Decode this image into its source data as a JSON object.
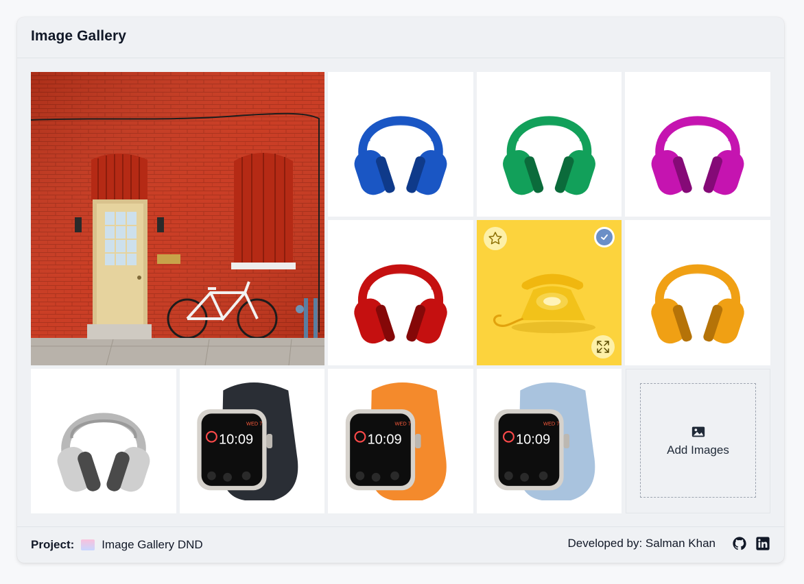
{
  "header": {
    "title": "Image Gallery"
  },
  "gallery": {
    "tiles": [
      {
        "id": "wall",
        "subject": "red brick wall with door and bicycle"
      },
      {
        "id": "hp-blue",
        "subject": "blue headphones",
        "color": "#1a56c4"
      },
      {
        "id": "hp-green",
        "subject": "green headphones",
        "color": "#12a05a"
      },
      {
        "id": "hp-magenta",
        "subject": "magenta headphones",
        "color": "#c514b0"
      },
      {
        "id": "hp-red",
        "subject": "red headphones",
        "color": "#c51010"
      },
      {
        "id": "phone",
        "subject": "yellow rotary telephone",
        "selected": true,
        "bg": "#fcd33d"
      },
      {
        "id": "hp-orange",
        "subject": "orange headphones",
        "color": "#f0a014"
      },
      {
        "id": "hp-silver",
        "subject": "silver headphones",
        "color": "#7c7c7c"
      },
      {
        "id": "watch-black",
        "subject": "watch with black band",
        "color": "#2a2e35"
      },
      {
        "id": "watch-orange",
        "subject": "watch with orange band",
        "color": "#f48a2c"
      },
      {
        "id": "watch-blue",
        "subject": "watch with light blue band",
        "color": "#a9c3de"
      }
    ],
    "watch_face": {
      "day": "WED 7",
      "time": "10:09"
    },
    "add_label": "Add Images"
  },
  "footer": {
    "project_label": "Project:",
    "project_name": "Image Gallery DND",
    "developed_by": "Developed by: Salman Khan"
  },
  "icons": {
    "star": "star-icon",
    "check": "check-icon",
    "expand": "expand-icon",
    "image": "image-icon",
    "github": "github-icon",
    "linkedin": "linkedin-icon"
  }
}
